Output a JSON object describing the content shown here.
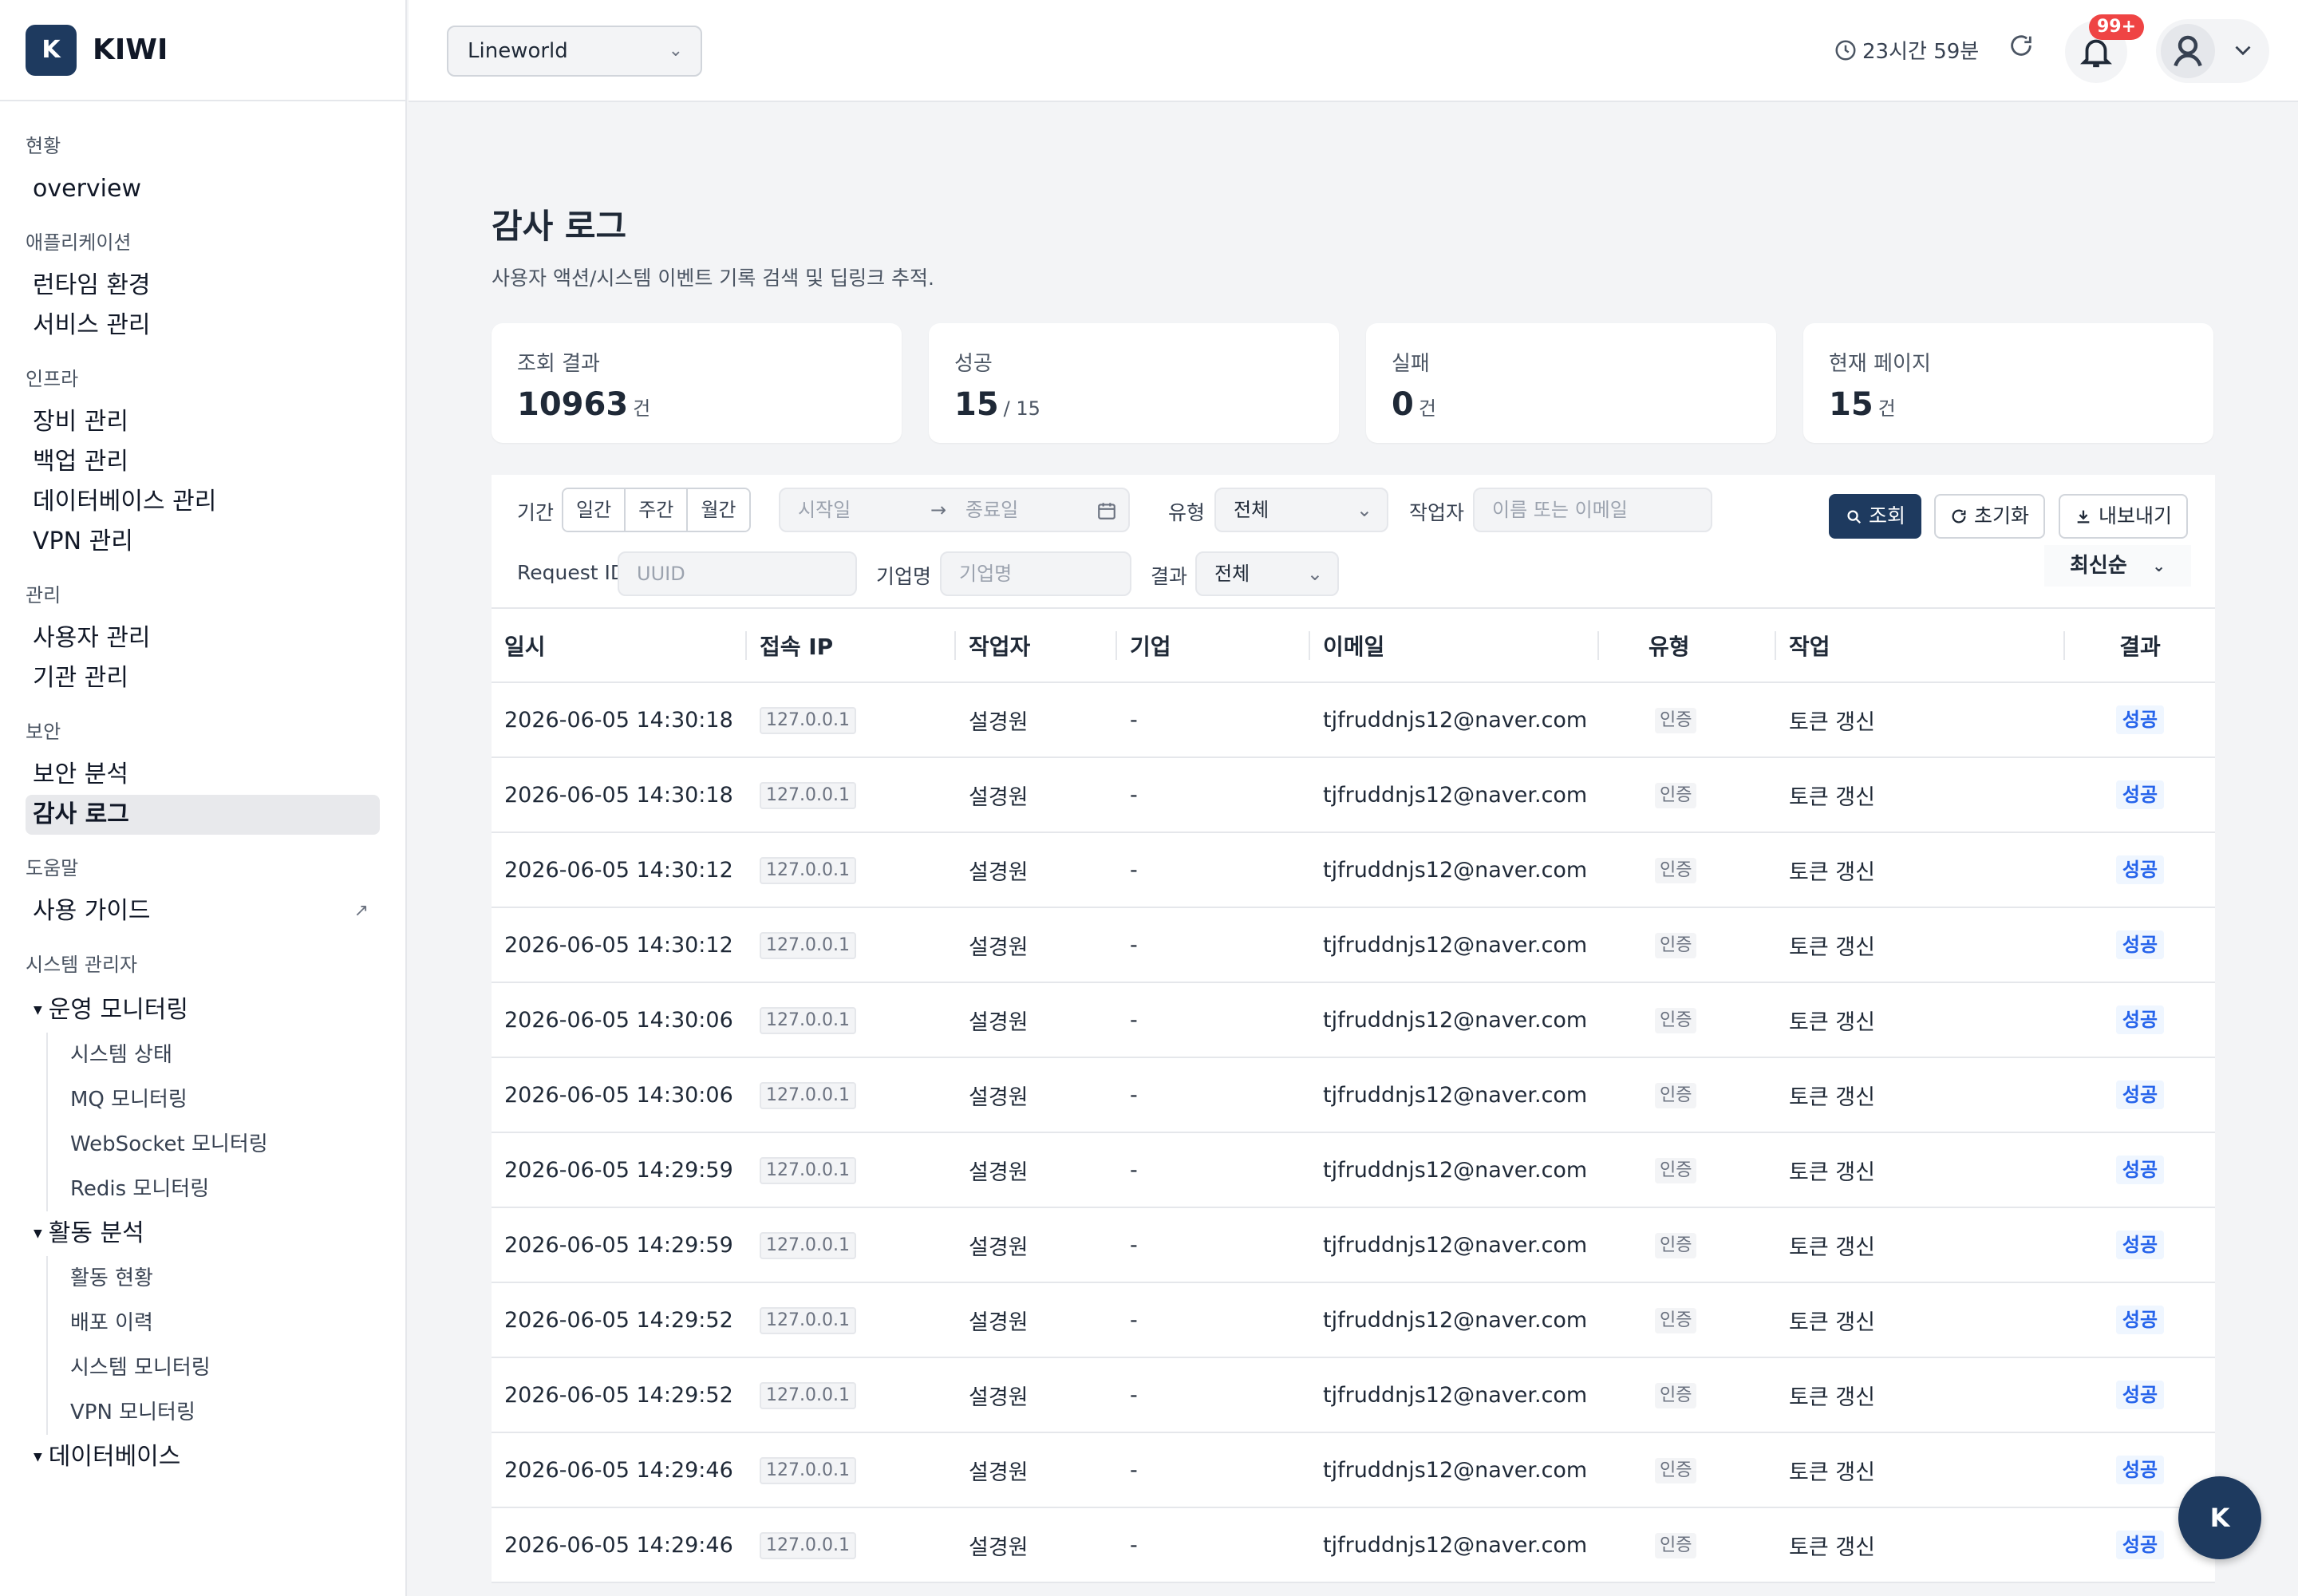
{
  "brand": {
    "logo_letter": "K",
    "name": "KIWI"
  },
  "sidebar": {
    "groups": [
      {
        "section": "현황",
        "items": [
          "overview"
        ]
      },
      {
        "section": "애플리케이션",
        "items": [
          "런타임 환경",
          "서비스 관리"
        ]
      },
      {
        "section": "인프라",
        "items": [
          "장비 관리",
          "백업 관리",
          "데이터베이스 관리",
          "VPN 관리"
        ]
      },
      {
        "section": "관리",
        "items": [
          "사용자 관리",
          "기관 관리"
        ]
      },
      {
        "section": "보안",
        "items": [
          "보안 분석",
          "감사 로그"
        ]
      },
      {
        "section": "도움말",
        "items": [
          "사용 가이드"
        ]
      }
    ],
    "admin_section": "시스템 관리자",
    "admin_groups": [
      {
        "label": "운영 모니터링",
        "items": [
          "시스템 상태",
          "MQ 모니터링",
          "WebSocket 모니터링",
          "Redis 모니터링"
        ]
      },
      {
        "label": "활동 분석",
        "items": [
          "활동 현황",
          "배포 이력",
          "시스템 모니터링",
          "VPN 모니터링"
        ]
      },
      {
        "label": "데이터베이스",
        "items": []
      }
    ],
    "active_item": "감사 로그"
  },
  "topbar": {
    "org_select": "Lineworld",
    "session_timer": "23시간 59분",
    "notification_badge": "99+"
  },
  "page": {
    "title": "감사 로그",
    "description": "사용자 액션/시스템 이벤트 기록 검색 및 딥링크 추적."
  },
  "stats": [
    {
      "label": "조회 결과",
      "value": "10963",
      "unit": "건"
    },
    {
      "label": "성공",
      "value": "15",
      "unit": "/ 15"
    },
    {
      "label": "실패",
      "value": "0",
      "unit": "건"
    },
    {
      "label": "현재 페이지",
      "value": "15",
      "unit": "건"
    }
  ],
  "filters": {
    "period_label": "기간",
    "period_options": [
      "일간",
      "주간",
      "월간"
    ],
    "start_placeholder": "시작일",
    "end_placeholder": "종료일",
    "type_label": "유형",
    "type_value": "전체",
    "actor_label": "작업자",
    "actor_placeholder": "이름 또는 이메일",
    "request_id_label": "Request ID",
    "request_id_placeholder": "UUID",
    "company_label": "기업명",
    "company_placeholder": "기업명",
    "result_label": "결과",
    "result_value": "전체",
    "search_button": "조회",
    "reset_button": "초기화",
    "export_button": "내보내기",
    "sort_value": "최신순"
  },
  "table": {
    "columns": [
      "일시",
      "접속 IP",
      "작업자",
      "기업",
      "이메일",
      "유형",
      "작업",
      "결과"
    ],
    "rows": [
      [
        "2026-06-05 14:30:18",
        "127.0.0.1",
        "설경원",
        "-",
        "tjfruddnjs12@naver.com",
        "인증",
        "토큰 갱신",
        "성공"
      ],
      [
        "2026-06-05 14:30:18",
        "127.0.0.1",
        "설경원",
        "-",
        "tjfruddnjs12@naver.com",
        "인증",
        "토큰 갱신",
        "성공"
      ],
      [
        "2026-06-05 14:30:12",
        "127.0.0.1",
        "설경원",
        "-",
        "tjfruddnjs12@naver.com",
        "인증",
        "토큰 갱신",
        "성공"
      ],
      [
        "2026-06-05 14:30:12",
        "127.0.0.1",
        "설경원",
        "-",
        "tjfruddnjs12@naver.com",
        "인증",
        "토큰 갱신",
        "성공"
      ],
      [
        "2026-06-05 14:30:06",
        "127.0.0.1",
        "설경원",
        "-",
        "tjfruddnjs12@naver.com",
        "인증",
        "토큰 갱신",
        "성공"
      ],
      [
        "2026-06-05 14:30:06",
        "127.0.0.1",
        "설경원",
        "-",
        "tjfruddnjs12@naver.com",
        "인증",
        "토큰 갱신",
        "성공"
      ],
      [
        "2026-06-05 14:29:59",
        "127.0.0.1",
        "설경원",
        "-",
        "tjfruddnjs12@naver.com",
        "인증",
        "토큰 갱신",
        "성공"
      ],
      [
        "2026-06-05 14:29:59",
        "127.0.0.1",
        "설경원",
        "-",
        "tjfruddnjs12@naver.com",
        "인증",
        "토큰 갱신",
        "성공"
      ],
      [
        "2026-06-05 14:29:52",
        "127.0.0.1",
        "설경원",
        "-",
        "tjfruddnjs12@naver.com",
        "인증",
        "토큰 갱신",
        "성공"
      ],
      [
        "2026-06-05 14:29:52",
        "127.0.0.1",
        "설경원",
        "-",
        "tjfruddnjs12@naver.com",
        "인증",
        "토큰 갱신",
        "성공"
      ],
      [
        "2026-06-05 14:29:46",
        "127.0.0.1",
        "설경원",
        "-",
        "tjfruddnjs12@naver.com",
        "인증",
        "토큰 갱신",
        "성공"
      ],
      [
        "2026-06-05 14:29:46",
        "127.0.0.1",
        "설경원",
        "-",
        "tjfruddnjs12@naver.com",
        "인증",
        "토큰 갱신",
        "성공"
      ]
    ]
  },
  "fab": {
    "label": "K"
  }
}
